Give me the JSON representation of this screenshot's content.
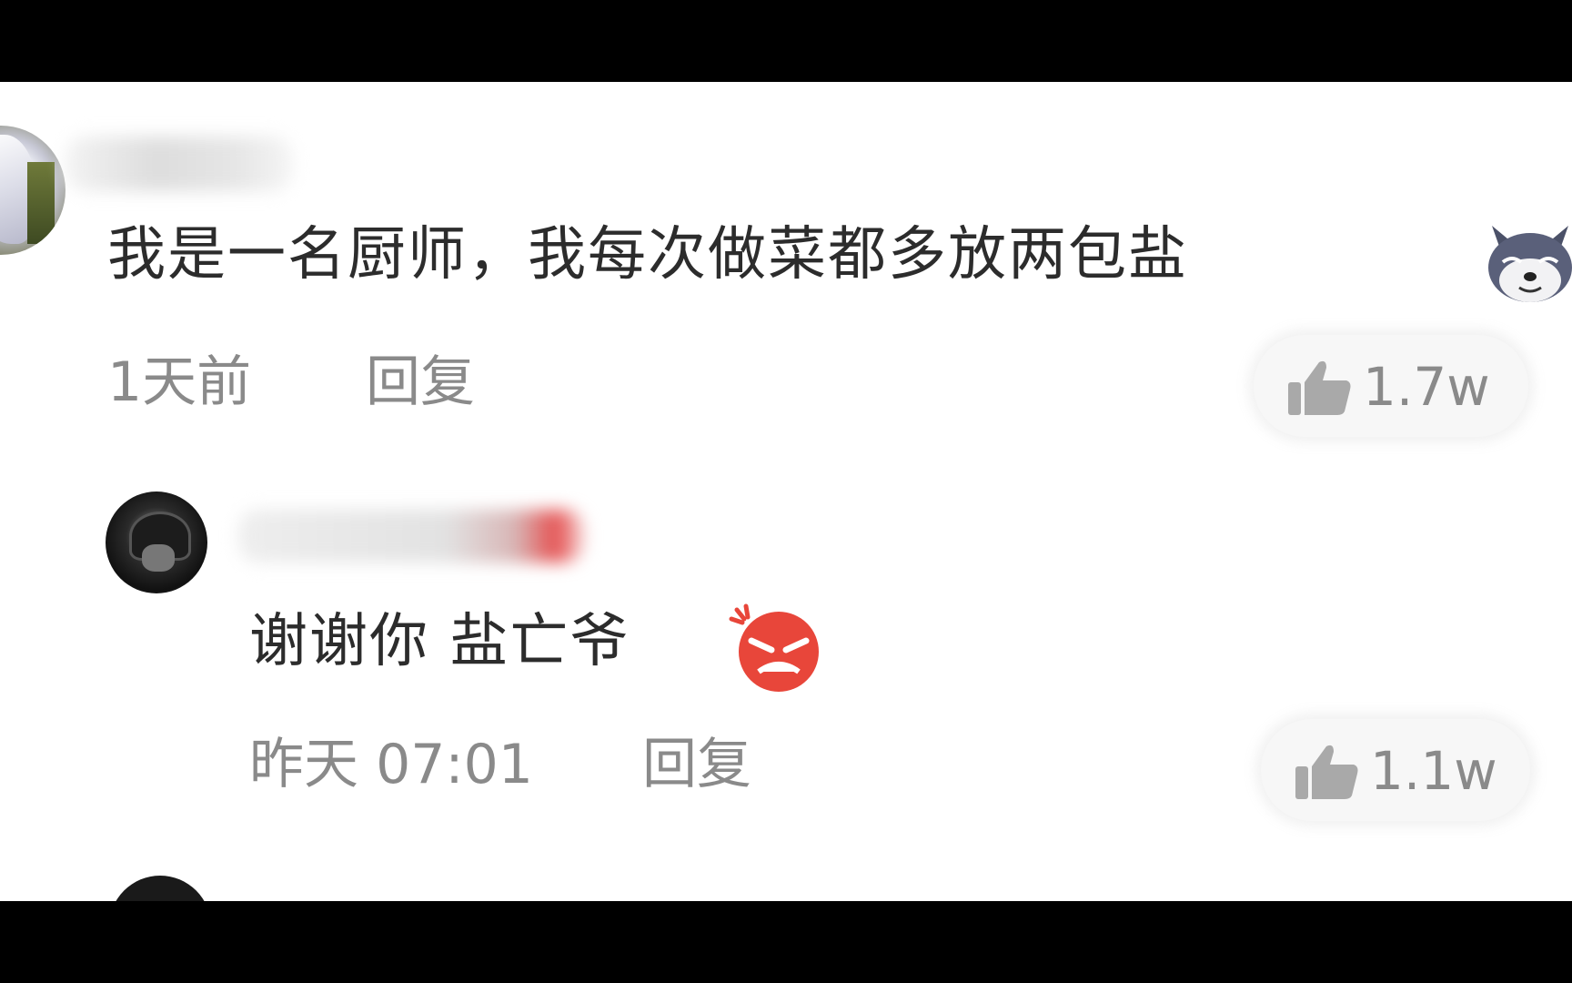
{
  "main_comment": {
    "text": "我是一名厨师，我每次做菜都多放两包盐",
    "time": "1天前",
    "reply_label": "回复",
    "likes": "1.7w",
    "emoji": "husky-dog-emoji"
  },
  "reply_comment": {
    "text": "谢谢你 盐亡爷",
    "time": "昨天 07:01",
    "reply_label": "回复",
    "likes": "1.1w",
    "emoji": "angry-face-emoji"
  },
  "colors": {
    "text_primary": "#2c2c2c",
    "text_secondary": "#8a8a8a",
    "background": "#ffffff",
    "letterbox": "#000000"
  }
}
